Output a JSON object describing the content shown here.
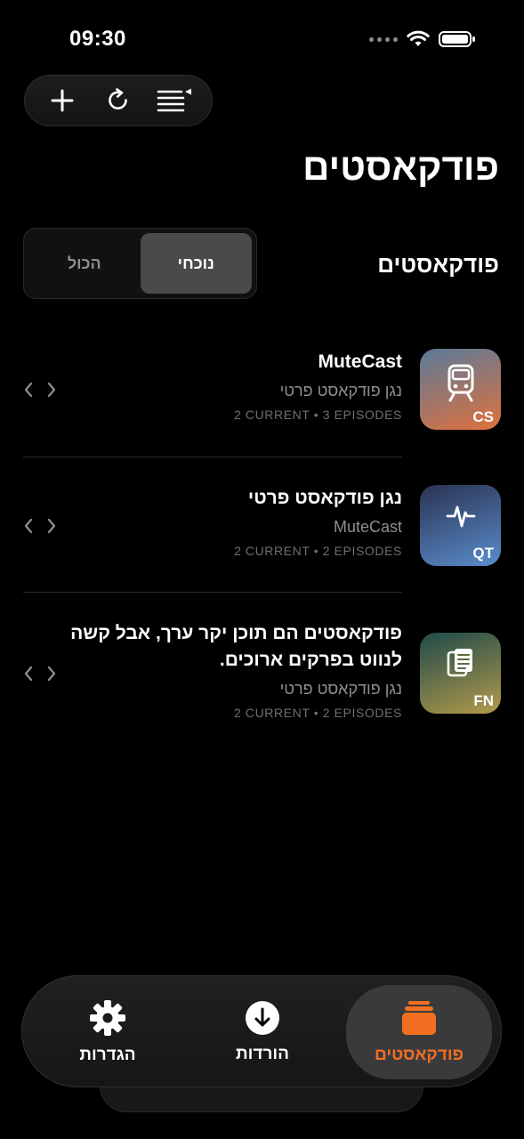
{
  "status": {
    "time": "09:30"
  },
  "toolbar": {
    "add_icon": "plus-icon",
    "refresh_icon": "refresh-icon",
    "queue_icon": "list-play-icon"
  },
  "page": {
    "title": "פודקאסטים"
  },
  "section": {
    "title": "פודקאסטים"
  },
  "segmented": {
    "current": "נוכחי",
    "all": "הכול",
    "selected": "current"
  },
  "podcasts": [
    {
      "title": "MuteCast",
      "subtitle": "נגן פודקאסט פרטי",
      "meta": "2 CURRENT • 3 EPISODES",
      "abbr": "CS",
      "icon": "train-icon",
      "colors": [
        "#5a7a9a",
        "#e0713d"
      ]
    },
    {
      "title": "נגן פודקאסט פרטי",
      "subtitle": "MuteCast",
      "meta": "2 CURRENT • 2 EPISODES",
      "abbr": "QT",
      "icon": "waveform-icon",
      "colors": [
        "#2a3352",
        "#5a8ccc"
      ]
    },
    {
      "title": "פודקאסטים הם תוכן יקר ערך, אבל קשה לנווט בפרקים ארוכים.",
      "subtitle": "נגן פודקאסט פרטי",
      "meta": "2 CURRENT • 2 EPISODES",
      "abbr": "FN",
      "icon": "document-icon",
      "colors": [
        "#1e4a4a",
        "#b39a4a"
      ]
    }
  ],
  "tabs": [
    {
      "label": "פודקאסטים",
      "icon": "stack-icon",
      "active": true,
      "color": "#f26f21"
    },
    {
      "label": "הורדות",
      "icon": "download-icon",
      "active": false,
      "color": "#ffffff"
    },
    {
      "label": "הגדרות",
      "icon": "gear-icon",
      "active": false,
      "color": "#ffffff"
    }
  ]
}
